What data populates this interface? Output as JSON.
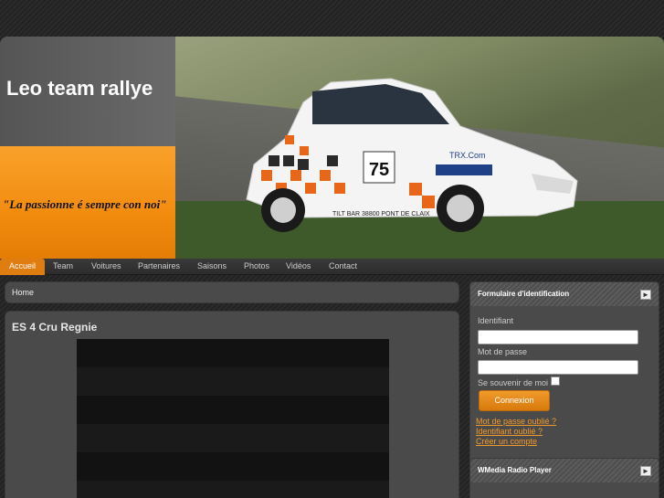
{
  "site": {
    "title": "Leo team rallye",
    "slogan": "\"La passionne é sempre con noi\""
  },
  "nav": {
    "items": [
      "Accueil",
      "Team",
      "Voitures",
      "Partenaires",
      "Saisons",
      "Photos",
      "Vidéos",
      "Contact"
    ],
    "active": "Accueil"
  },
  "breadcrumb": {
    "home": "Home"
  },
  "article": {
    "title": "ES 4 Cru Regnie"
  },
  "car": {
    "number": "75",
    "plate_text": "TILT BAR 38800 PONT DE CLAIX",
    "sponsor": "TRX.Com"
  },
  "login": {
    "title": "Formulaire d'identification",
    "username_label": "Identifiant",
    "username_value": "",
    "password_label": "Mot de passe",
    "password_value": "",
    "remember_label": "Se souvenir de moi",
    "submit_label": "Connexion",
    "forgot_password": "Mot de passe oublié ?",
    "forgot_username": "Identifiant oublié ?",
    "create_account": "Créer un compte"
  },
  "radio": {
    "title": "WMedia Radio Player"
  },
  "colors": {
    "accent": "#e07d10",
    "panel": "#4a4a4a",
    "link": "#f29a2c"
  }
}
